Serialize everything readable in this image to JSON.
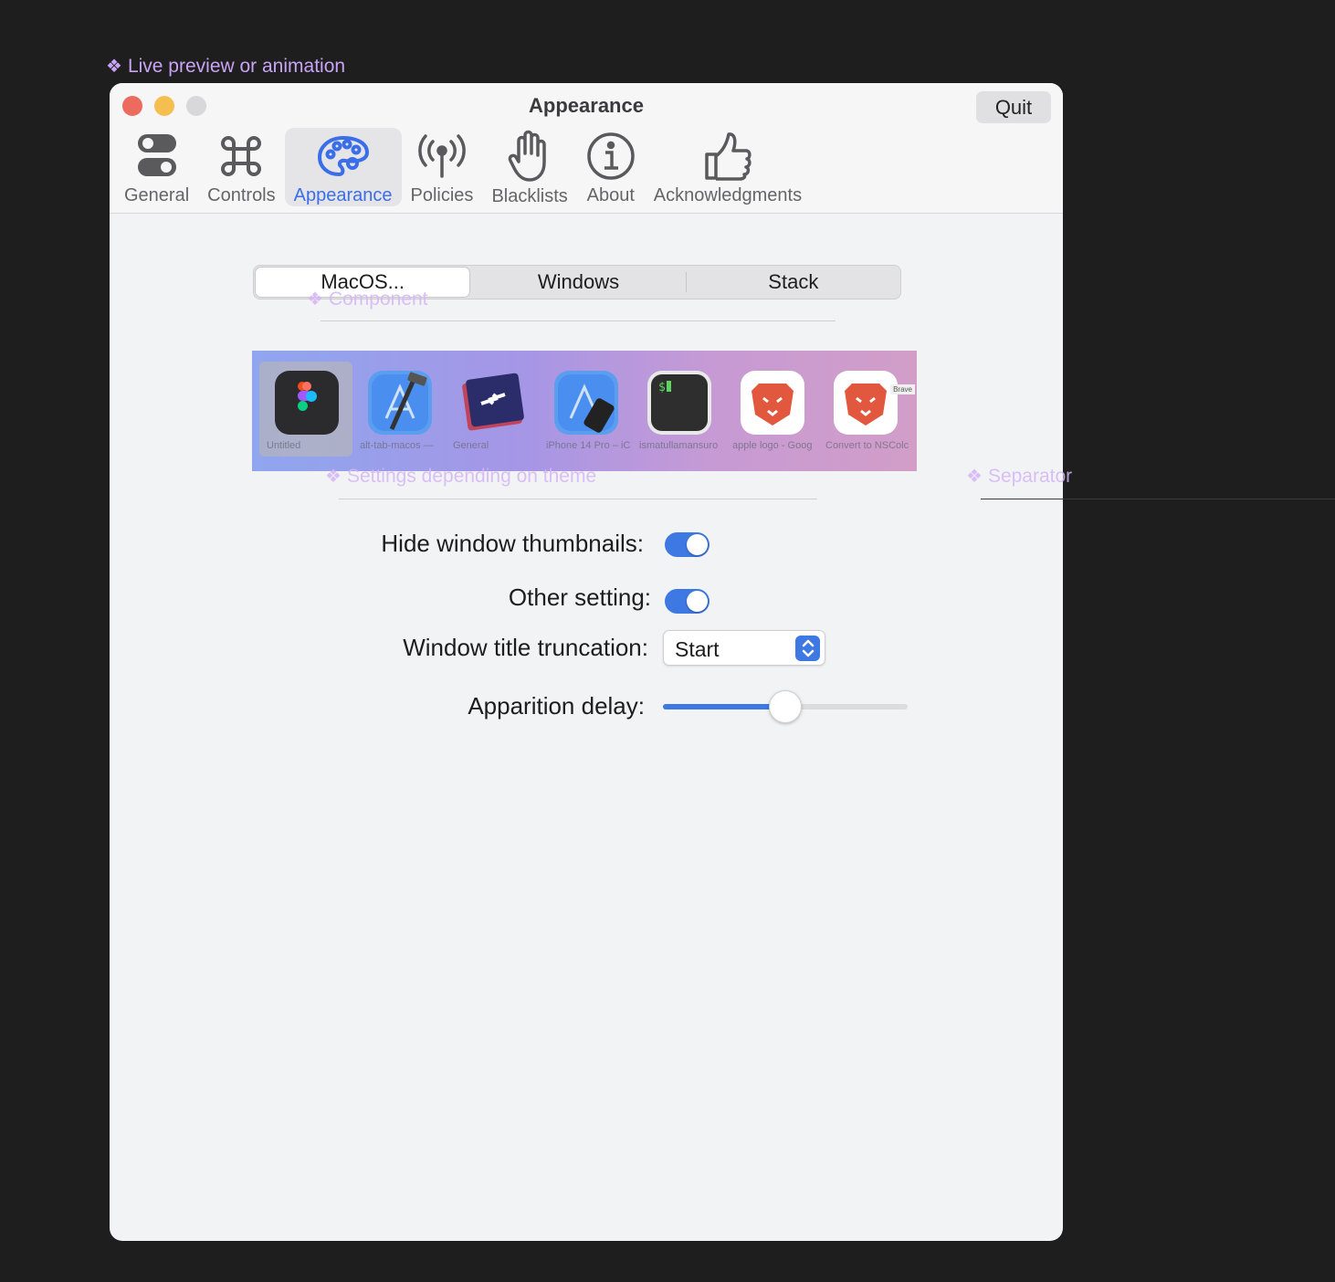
{
  "annotations": {
    "live_preview": "Live preview or animation",
    "component": "Component",
    "settings_theme": "Settings depending on theme",
    "separator": "Separator"
  },
  "window": {
    "title": "Appearance",
    "quit_label": "Quit"
  },
  "tabs": [
    {
      "label": "General",
      "icon": "toggles-icon"
    },
    {
      "label": "Controls",
      "icon": "command-icon"
    },
    {
      "label": "Appearance",
      "icon": "palette-icon"
    },
    {
      "label": "Policies",
      "icon": "antenna-icon"
    },
    {
      "label": "Blacklists",
      "icon": "hand-icon"
    },
    {
      "label": "About",
      "icon": "info-icon"
    },
    {
      "label": "Acknowledgments",
      "icon": "thumbs-up-icon"
    }
  ],
  "segmented": {
    "options": [
      "MacOS...",
      "Windows",
      "Stack"
    ],
    "selected": "MacOS..."
  },
  "preview": {
    "thumbnails": [
      {
        "caption": "Untitled",
        "icon": "figma-icon"
      },
      {
        "caption": "alt-tab-macos —",
        "icon": "xcode-icon"
      },
      {
        "caption": "General",
        "icon": "alttab-icon"
      },
      {
        "caption": "iPhone 14 Pro – iC",
        "icon": "simulator-icon"
      },
      {
        "caption": "ismatullamansuro",
        "icon": "terminal-icon"
      },
      {
        "caption": "apple logo - Goog",
        "icon": "brave-icon"
      },
      {
        "caption": "Convert to NSColc",
        "icon": "brave-icon"
      }
    ],
    "tooltip": "Brave"
  },
  "settings": {
    "hide_thumbnails_label": "Hide window thumbnails:",
    "hide_thumbnails_on": true,
    "other_label": "Other setting:",
    "other_on": true,
    "truncation_label": "Window title truncation:",
    "truncation_value": "Start",
    "delay_label": "Apparition delay:",
    "delay_fraction": 0.5
  },
  "colors": {
    "accent": "#3d78e3",
    "figma_annotation": "#c9a3f5"
  }
}
